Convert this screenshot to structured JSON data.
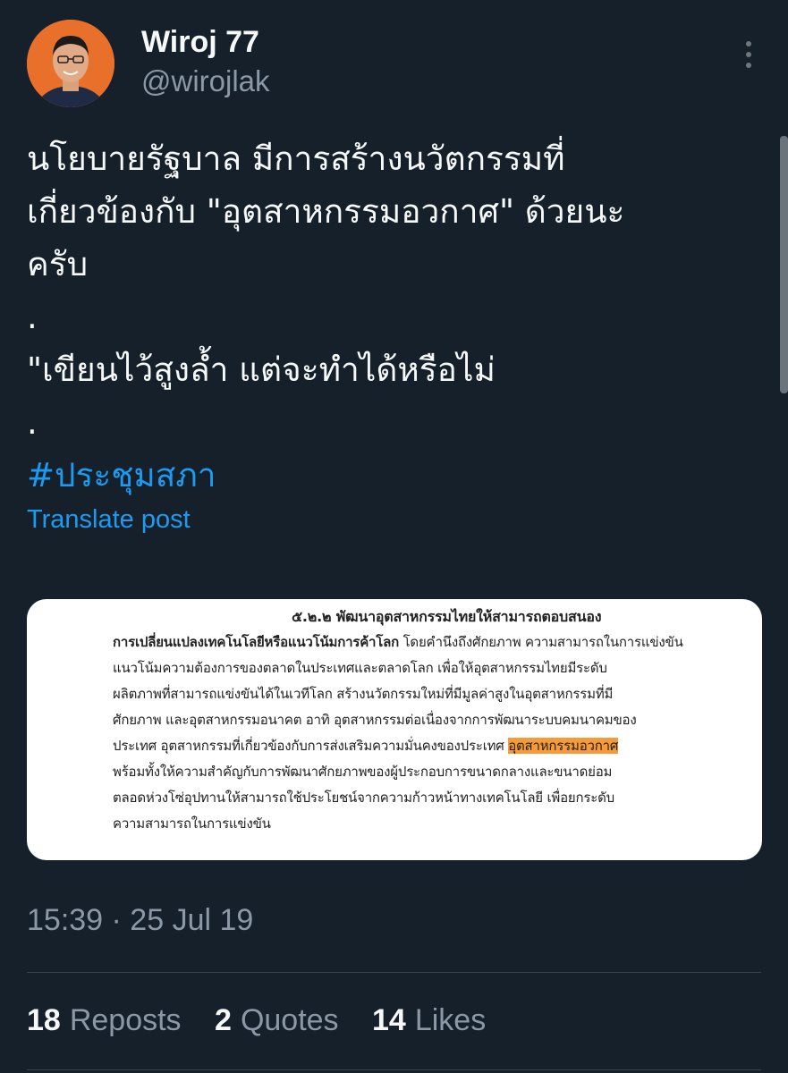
{
  "author": {
    "name": "Wiroj 77",
    "handle": "@wirojlak"
  },
  "tweet": {
    "lines": [
      "นโยบายรัฐบาล มีการสร้างนวัตกรรมที่",
      "เกี่ยวข้องกับ \"อุตสาหกรรมอวกาศ\" ด้วยนะ",
      "ครับ",
      ".",
      "\"เขียนไว้สูงล้ำ แต่จะทำได้หรือไม่",
      "."
    ],
    "hashtag": "#ประชุมสภา",
    "translate_label": "Translate post"
  },
  "media_doc": {
    "line1": "๕.๒.๒   พัฒนาอุตสาหกรรมไทยให้สามารถตอบสนอง",
    "line2_bold": "การเปลี่ยนแปลงเทคโนโลยีหรือแนวโน้มการค้าโลก",
    "line2_rest": " โดยคำนึงถึงศักยภาพ ความสามารถในการแข่งขัน",
    "line3": "แนวโน้มความต้องการของตลาดในประเทศและตลาดโลก  เพื่อให้อุตสาหกรรมไทยมีระดับ",
    "line4": "ผลิตภาพที่สามารถแข่งขันได้ในเวทีโลก  สร้างนวัตกรรมใหม่ที่มีมูลค่าสูงในอุตสาหกรรมที่มี",
    "line5": "ศักยภาพ  และอุตสาหกรรมอนาคต  อาทิ  อุตสาหกรรมต่อเนื่องจากการพัฒนาระบบคมนาคมของ",
    "line6_pre": "ประเทศ  อุตสาหกรรมที่เกี่ยวข้องกับการส่งเสริมความมั่นคงของประเทศ  ",
    "line6_hl": "อุตสาหกรรมอวกาศ",
    "line7": "พร้อมทั้งให้ความสำคัญกับการพัฒนาศักยภาพของผู้ประกอบการขนาดกลางและขนาดย่อม",
    "line8": "ตลอดห่วงโซ่อุปทานให้สามารถใช้ประโยชน์จากความก้าวหน้าทางเทคโนโลยี  เพื่อยกระดับ",
    "line9": "ความสามารถในการแข่งขัน"
  },
  "timestamp": "15:39 · 25 Jul 19",
  "stats": {
    "reposts_count": "18",
    "reposts_label": "Reposts",
    "quotes_count": "2",
    "quotes_label": "Quotes",
    "likes_count": "14",
    "likes_label": "Likes"
  },
  "icons": {
    "more": "more-vertical-icon",
    "avatar": "profile-photo"
  },
  "colors": {
    "background": "#15202b",
    "link": "#1d9bf0",
    "highlight": "#f79b3a"
  }
}
